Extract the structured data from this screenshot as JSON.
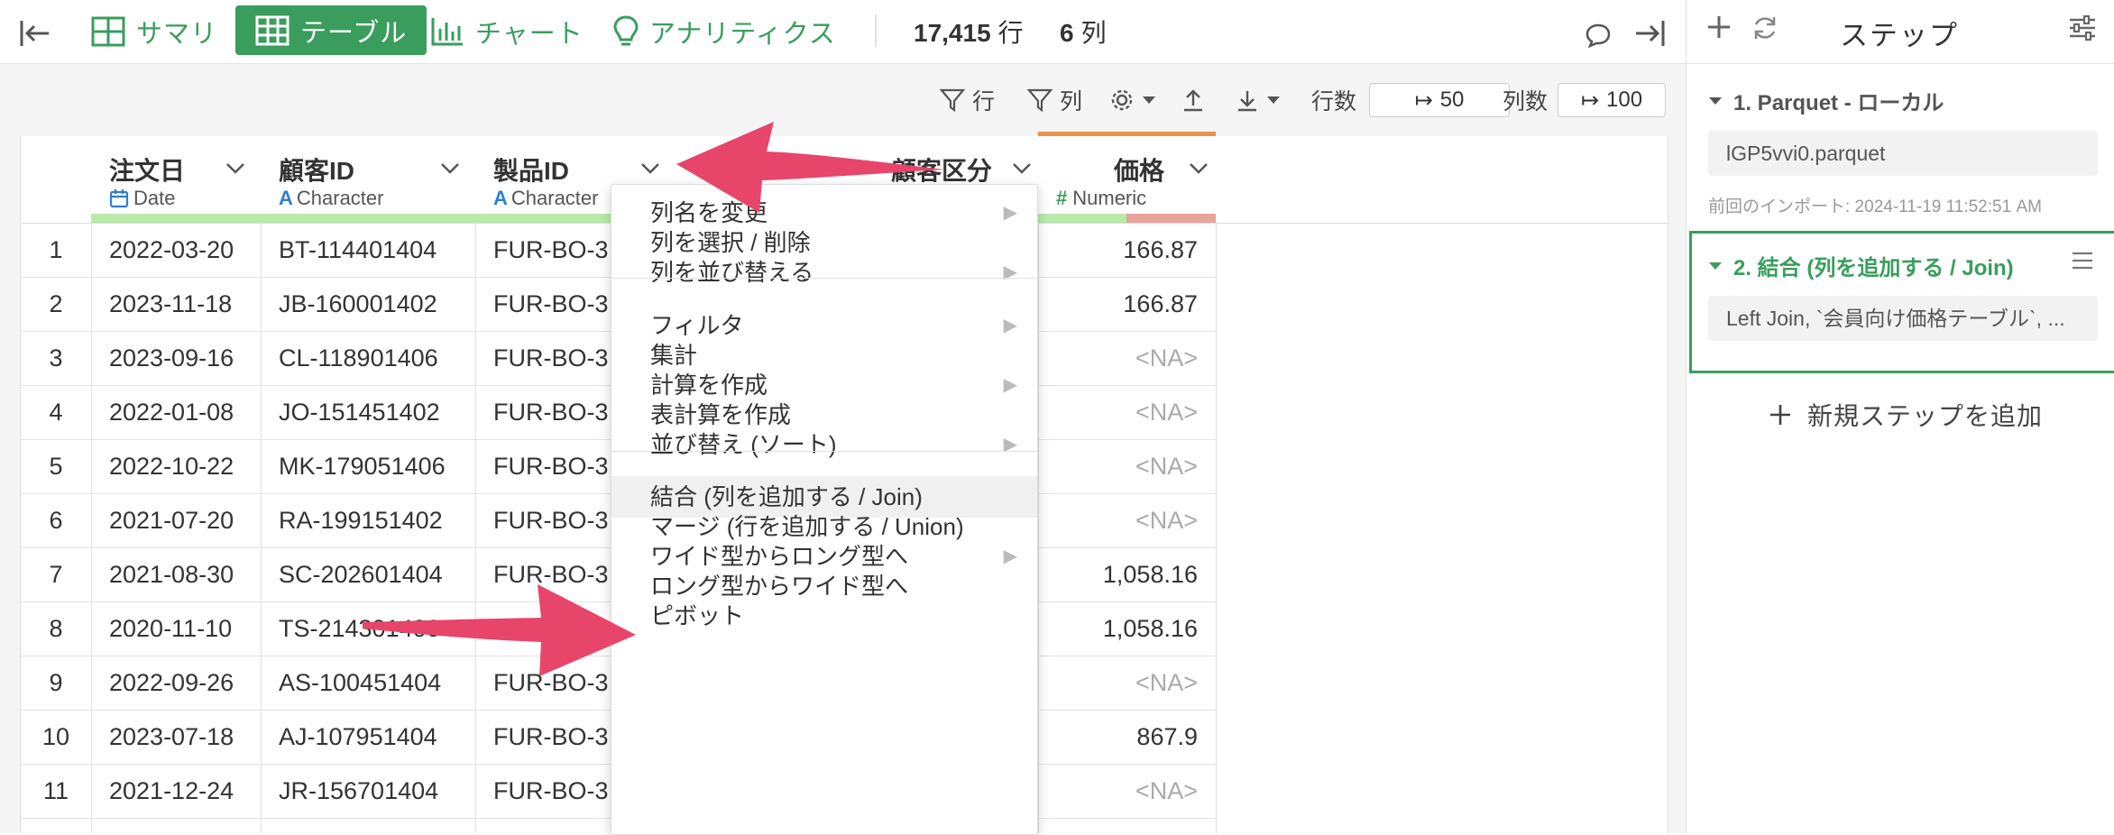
{
  "toolbar": {
    "tabs": [
      {
        "label": "サマリ",
        "icon": "summary-grid-icon"
      },
      {
        "label": "テーブル",
        "icon": "table-icon",
        "active": true
      },
      {
        "label": "チャート",
        "icon": "bar-chart-icon"
      },
      {
        "label": "アナリティクス",
        "icon": "lightbulb-icon"
      }
    ],
    "row_count": "17,415",
    "row_unit": "行",
    "col_count": "6",
    "col_unit": "列",
    "accent_color": "#3a9d5d"
  },
  "subbar": {
    "filter_row": "行",
    "filter_col": "列",
    "rows_label": "行数",
    "rows_value": "50",
    "cols_label": "列数",
    "cols_value": "100"
  },
  "columns": [
    {
      "name": "注文日",
      "type": "Date",
      "type_icon": "calendar-icon"
    },
    {
      "name": "顧客ID",
      "type": "Character",
      "type_icon": "character-A-icon"
    },
    {
      "name": "製品ID",
      "type": "Character",
      "type_icon": "character-A-icon"
    },
    {
      "name": "",
      "type": "",
      "type_icon": ""
    },
    {
      "name": "顧客区分",
      "type": "",
      "type_icon": ""
    },
    {
      "name": "価格",
      "type": "Numeric",
      "type_icon": "hash-icon"
    }
  ],
  "rows": [
    {
      "n": "1",
      "date": "2022-03-20",
      "cust": "BT-114401404",
      "prod": "FUR-BO-3",
      "price": "166.87"
    },
    {
      "n": "2",
      "date": "2023-11-18",
      "cust": "JB-160001402",
      "prod": "FUR-BO-3",
      "price": "166.87"
    },
    {
      "n": "3",
      "date": "2023-09-16",
      "cust": "CL-118901406",
      "prod": "FUR-BO-3",
      "price": "<NA>"
    },
    {
      "n": "4",
      "date": "2022-01-08",
      "cust": "JO-151451402",
      "prod": "FUR-BO-3",
      "price": "<NA>"
    },
    {
      "n": "5",
      "date": "2022-10-22",
      "cust": "MK-179051406",
      "prod": "FUR-BO-3",
      "price": "<NA>"
    },
    {
      "n": "6",
      "date": "2021-07-20",
      "cust": "RA-199151402",
      "prod": "FUR-BO-3",
      "price": "<NA>"
    },
    {
      "n": "7",
      "date": "2021-08-30",
      "cust": "SC-202601404",
      "prod": "FUR-BO-3",
      "price": "1,058.16"
    },
    {
      "n": "8",
      "date": "2020-11-10",
      "cust": "TS-214301406",
      "prod": "FUR-BO-3",
      "price": "1,058.16"
    },
    {
      "n": "9",
      "date": "2022-09-26",
      "cust": "AS-100451404",
      "prod": "FUR-BO-3",
      "price": "<NA>"
    },
    {
      "n": "10",
      "date": "2023-07-18",
      "cust": "AJ-107951404",
      "prod": "FUR-BO-3",
      "price": "867.9"
    },
    {
      "n": "11",
      "date": "2021-12-24",
      "cust": "JR-156701404",
      "prod": "FUR-BO-3",
      "price": "<NA>"
    }
  ],
  "menu": {
    "items": [
      {
        "label": "列名を変更",
        "submenu": true
      },
      {
        "label": "列を選択 / 削除",
        "submenu": false
      },
      {
        "label": "列を並び替える",
        "submenu": true
      },
      {
        "label": "フィルタ",
        "submenu": true
      },
      {
        "label": "集計",
        "submenu": false
      },
      {
        "label": "計算を作成",
        "submenu": true
      },
      {
        "label": "表計算を作成",
        "submenu": false
      },
      {
        "label": "並び替え (ソート)",
        "submenu": true
      },
      {
        "label": "結合 (列を追加する / Join)",
        "submenu": false,
        "highlighted": true
      },
      {
        "label": "マージ (行を追加する / Union)",
        "submenu": false
      },
      {
        "label": "ワイド型からロング型へ",
        "submenu": true
      },
      {
        "label": "ロング型からワイド型へ",
        "submenu": false
      },
      {
        "label": "ピボット",
        "submenu": false
      }
    ]
  },
  "steps_panel": {
    "title": "ステップ",
    "steps": [
      {
        "title": "1. Parquet - ローカル",
        "detail": "lGP5vvi0.parquet",
        "note": "前回のインポート: 2024-11-19 11:52:51 AM"
      },
      {
        "title": "2. 結合 (列を追加する / Join)",
        "detail": "Left Join, `会員向け価格テーブル`, ..."
      }
    ],
    "add_step": "新規ステップを追加"
  },
  "annotation_color": "#e8456b"
}
